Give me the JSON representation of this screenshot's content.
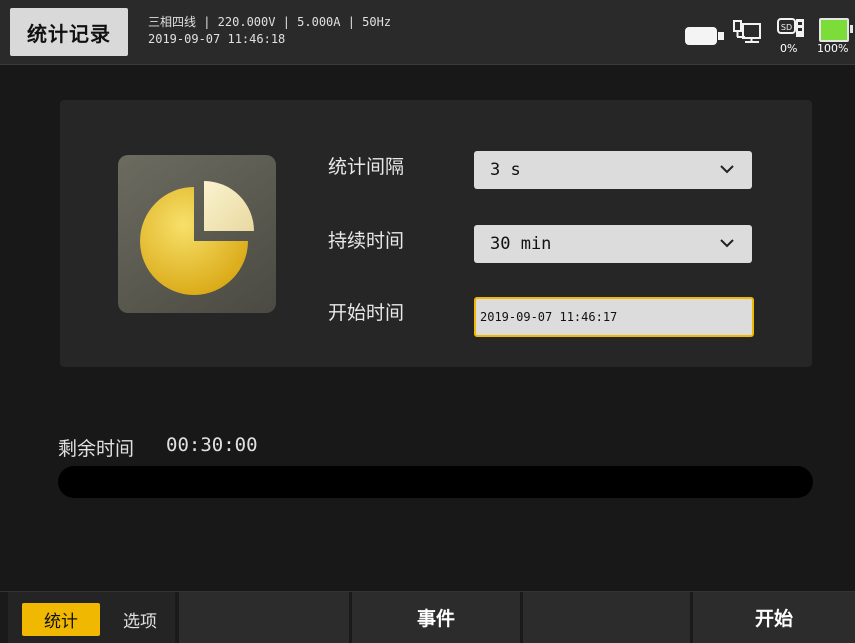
{
  "header": {
    "title": "统计记录",
    "status_line1": "三相四线 | 220.000V | 5.000A | 50Hz",
    "status_line2": "2019-09-07 11:46:18",
    "sd_percent": "0%",
    "battery_percent": "100%",
    "icons": [
      "usb-icon",
      "network-icon",
      "sd-card-icon",
      "battery-icon"
    ]
  },
  "form": {
    "interval_label": "统计间隔",
    "interval_value": "3 s",
    "duration_label": "持续时间",
    "duration_value": "30 min",
    "start_label": "开始时间",
    "start_value": "2019-09-07 11:46:17"
  },
  "remaining": {
    "label": "剩余时间",
    "value": "00:30:00",
    "progress": 0
  },
  "bottom": {
    "tab_stats": "统计",
    "tab_options": "选项",
    "key2": "",
    "key3": "事件",
    "key4": "",
    "key5": "开始"
  },
  "colors": {
    "accent": "#f0b800",
    "battery": "#7bdc3a",
    "background": "#181818",
    "panel": "#262626"
  }
}
